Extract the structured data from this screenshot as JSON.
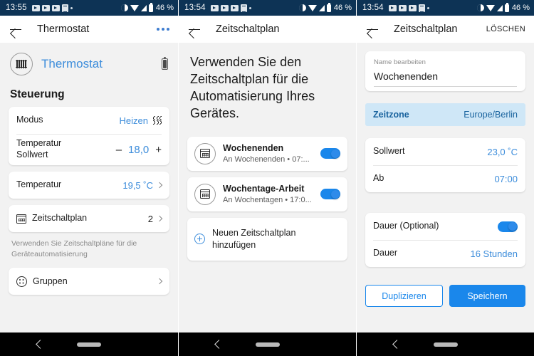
{
  "panels": [
    {
      "status": {
        "time": "13:55",
        "battery_pct": "46 %"
      },
      "appbar": {
        "title": "Thermostat",
        "menu_icon": "kebab-menu-icon",
        "back_icon": "back-arrow-icon"
      },
      "device": {
        "name": "Thermostat",
        "icon": "radiator-icon",
        "battery_icon": "battery-icon"
      },
      "section_title": "Steuerung",
      "rows": {
        "mode_label": "Modus",
        "mode_value": "Heizen",
        "mode_icon": "heat-waves-icon",
        "setpoint_label": "Temperatur\nSollwert",
        "setpoint_minus": "–",
        "setpoint_value": "18,0",
        "setpoint_plus": "+",
        "temperature_label": "Temperatur",
        "temperature_value": "19,5 ˚C",
        "schedule_label": "Zeitschaltplan",
        "schedule_count": "2",
        "groups_label": "Gruppen"
      },
      "hint": "Verwenden Sie Zeitschaltpläne für die Geräteautomatisierung"
    },
    {
      "status": {
        "time": "13:54",
        "battery_pct": "46 %"
      },
      "appbar": {
        "title": "Zeitschaltplan",
        "back_icon": "back-arrow-icon"
      },
      "intro": "Verwenden Sie den Zeitschaltplan für die Automatisierung Ihres Gerätes.",
      "schedules": [
        {
          "name": "Wochenenden",
          "subtitle": "An Wochenenden • 07:...",
          "icon": "calendar-icon",
          "enabled": true
        },
        {
          "name": "Wochentage-Arbeit",
          "subtitle": "An Wochentagen • 17:0...",
          "icon": "calendar-icon",
          "enabled": true
        }
      ],
      "add_label": "Neuen Zeitschaltplan hinzufügen",
      "add_icon": "plus-circle-icon"
    },
    {
      "status": {
        "time": "13:54",
        "battery_pct": "46 %"
      },
      "appbar": {
        "title": "Zeitschaltplan",
        "action": "LÖSCHEN",
        "back_icon": "back-arrow-icon"
      },
      "name_field": {
        "label": "Name bearbeiten",
        "value": "Wochenenden"
      },
      "timezone": {
        "label": "Zeitzone",
        "value": "Europe/Berlin"
      },
      "setpoint": {
        "label": "Sollwert",
        "value": "23,0 ˚C"
      },
      "from": {
        "label": "Ab",
        "value": "07:00"
      },
      "duration_toggle": {
        "label": "Dauer (Optional)",
        "enabled": true
      },
      "duration": {
        "label": "Dauer",
        "value": "16 Stunden"
      },
      "buttons": {
        "duplicate": "Duplizieren",
        "save": "Speichern"
      }
    }
  ],
  "colors": {
    "statusbar": "#0d3355",
    "accent": "#3d8ddb",
    "toggle_on": "#1a87eb",
    "highlight": "#cfe7f7",
    "page_bg": "#f2f2f2"
  }
}
